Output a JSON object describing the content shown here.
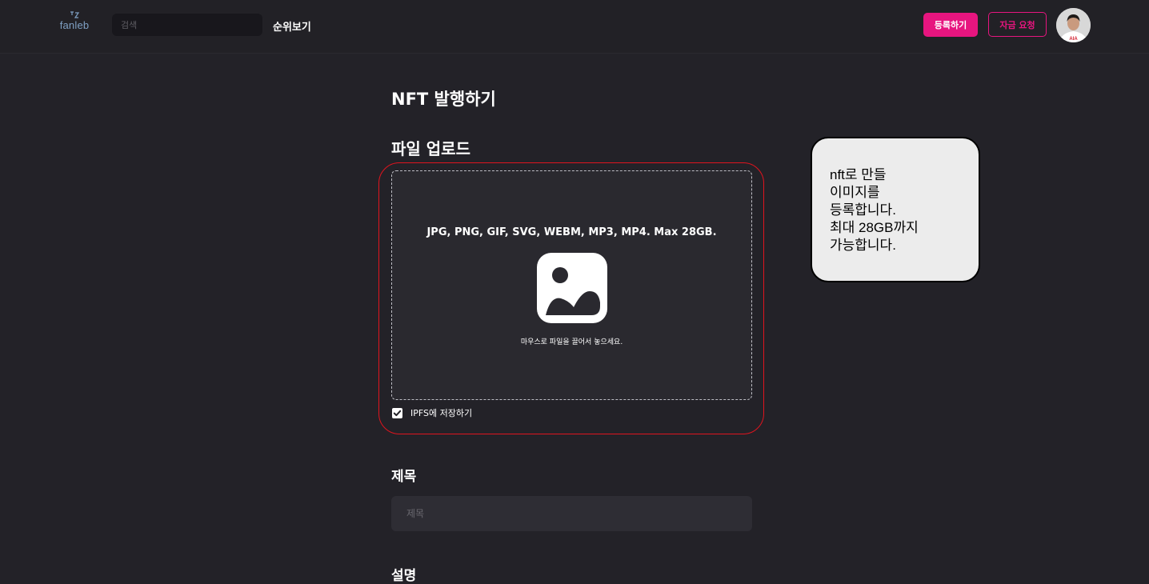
{
  "header": {
    "logo_text": "fanleb",
    "search_placeholder": "검색",
    "nav_rank": "순위보기",
    "register_label": "등록하기",
    "fund_label": "자금 요청",
    "accent_color": "#e7157f"
  },
  "main": {
    "page_title": "NFT 발행하기",
    "upload_section_title": "파일 업로드",
    "upload": {
      "formats": "JPG, PNG, GIF, SVG, WEBM, MP3, MP4. Max 28GB.",
      "hint": "마우스로 파일을 끌어서 놓으세요.",
      "icon": "image-icon"
    },
    "ipfs": {
      "label": "IPFS에 저장하기",
      "checked": true
    },
    "title_section": "제목",
    "title_placeholder": "제목",
    "description_section": "설명"
  },
  "callout": {
    "lines": [
      "nft로 만들",
      "이미지를",
      "등록합니다.",
      "최대 28GB까지",
      "가능합니다."
    ]
  }
}
